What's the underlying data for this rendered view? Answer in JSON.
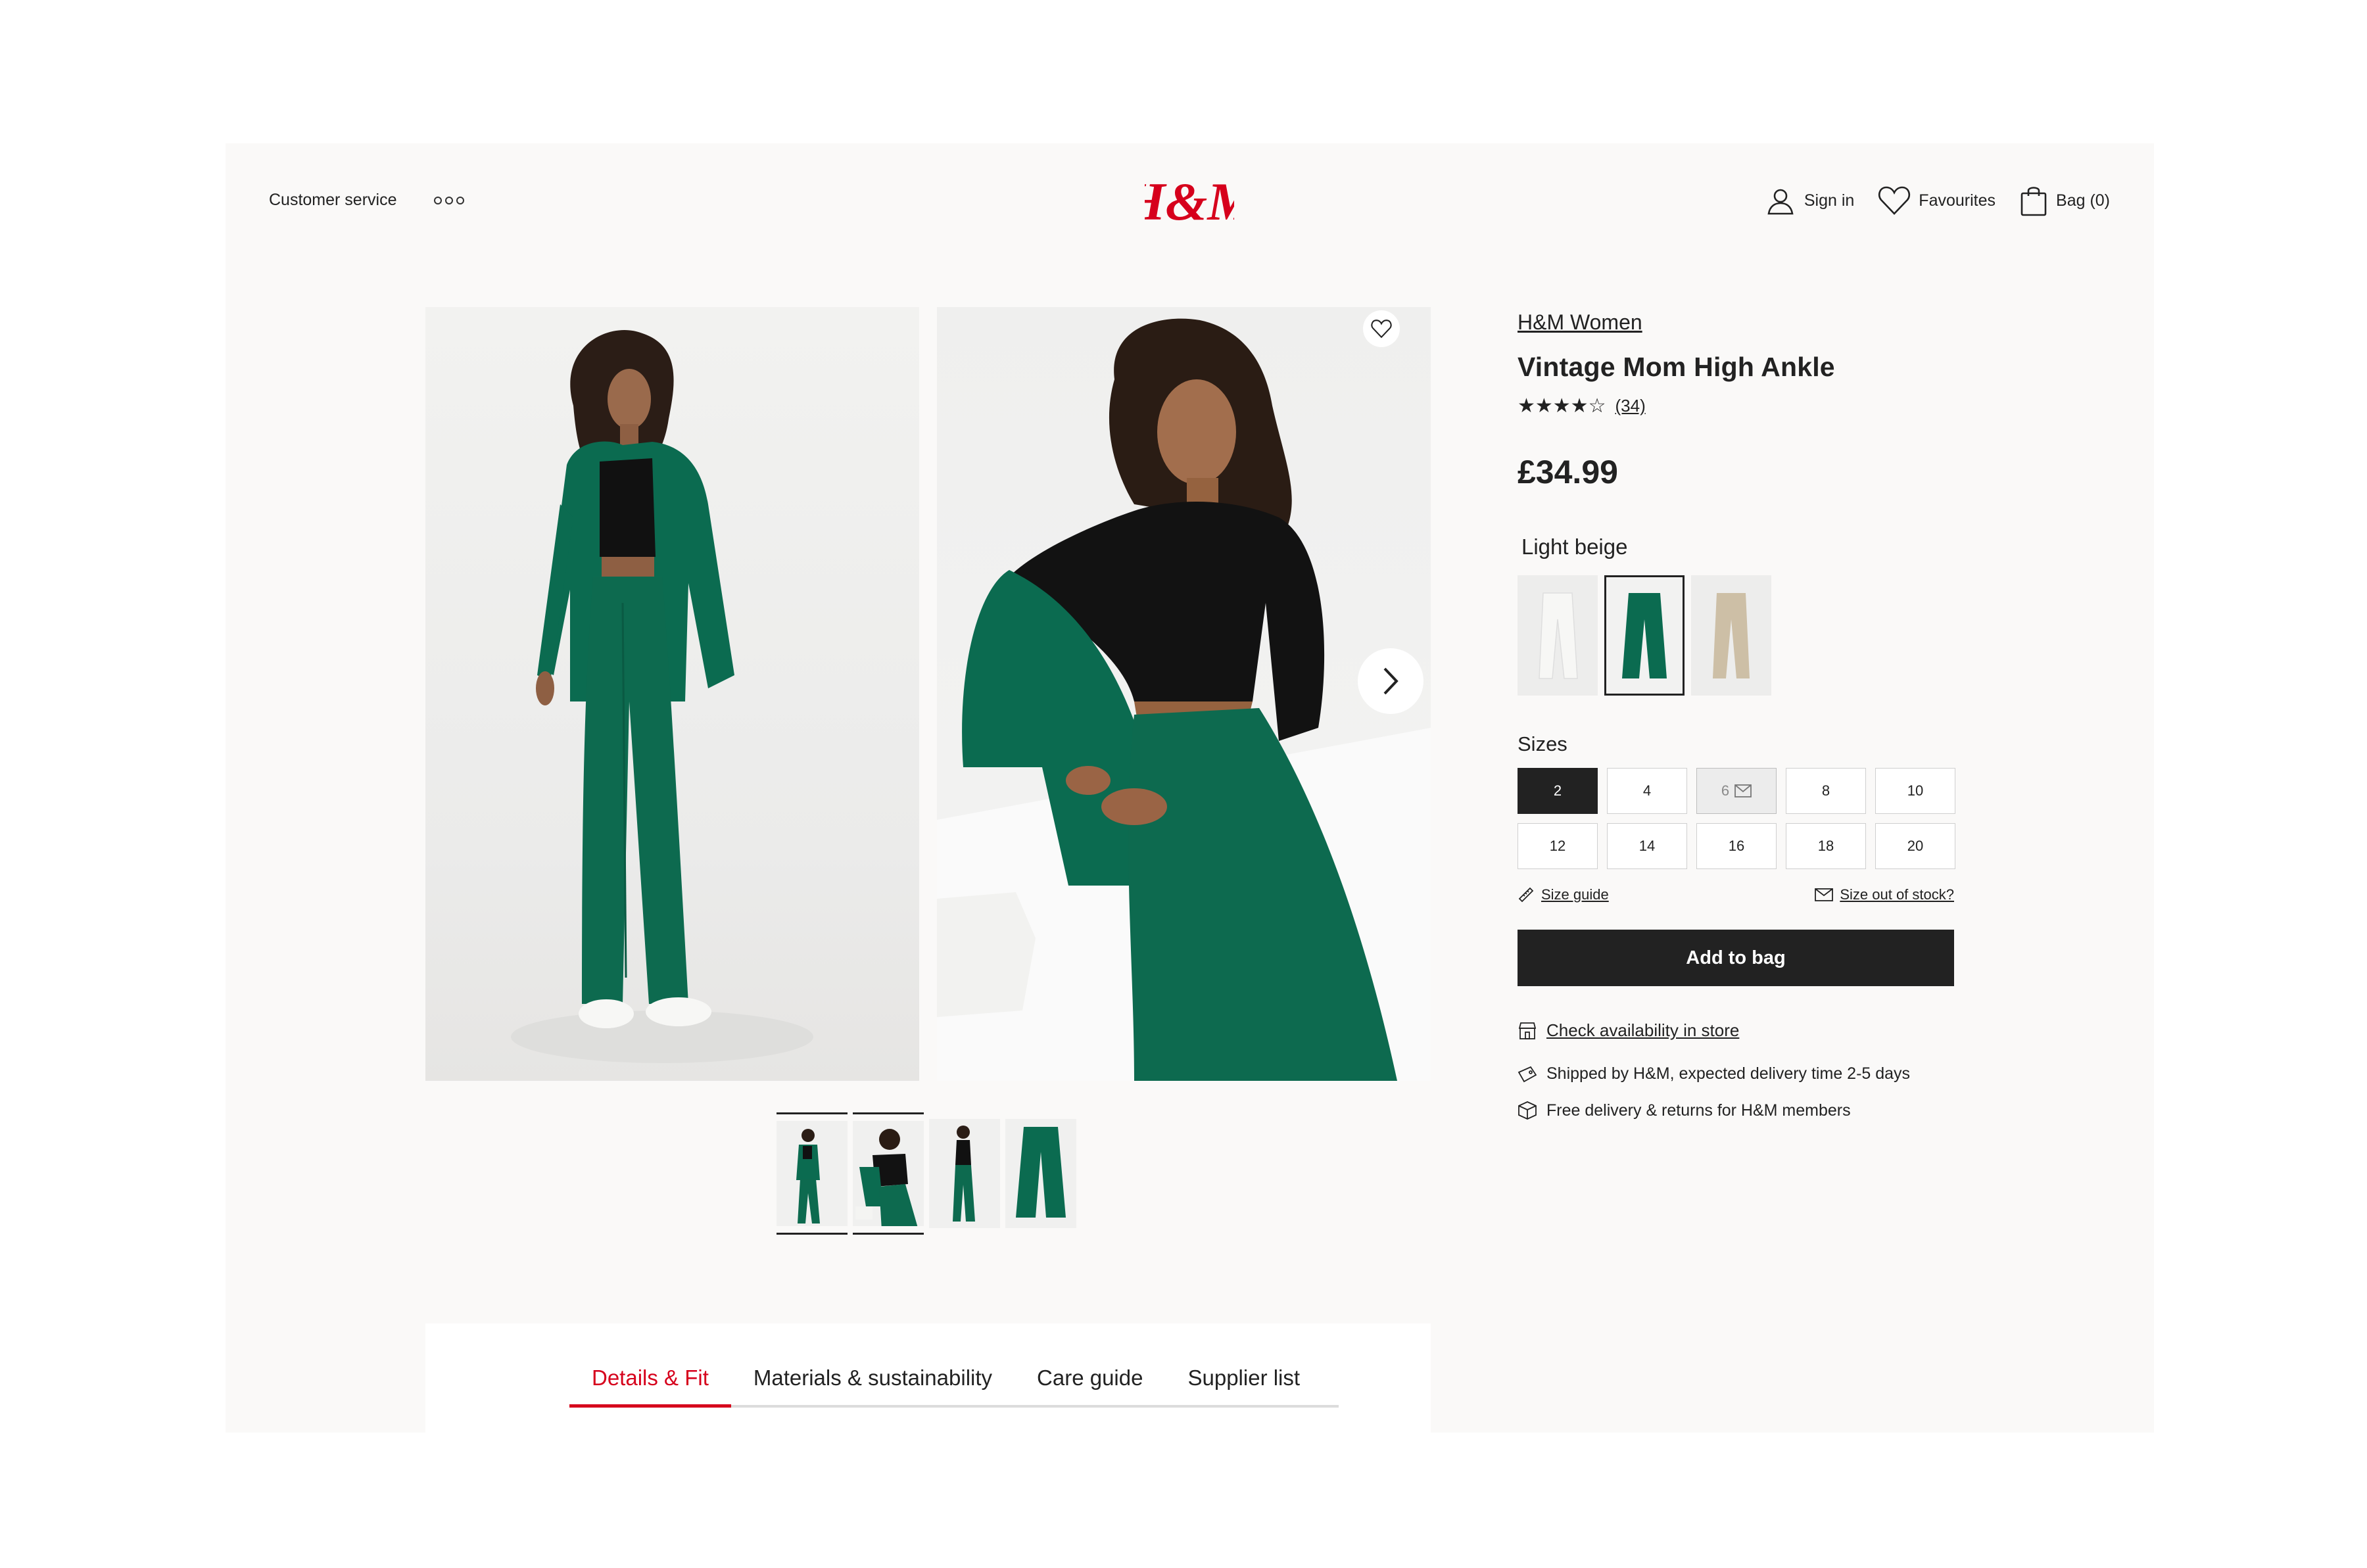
{
  "header": {
    "customer_service": "Customer service",
    "more_icon": "more-dots-icon",
    "logo": "H&M",
    "sign_in": "Sign in",
    "favourites": "Favourites",
    "bag": "Bag (0)"
  },
  "product": {
    "brand": "H&M Women",
    "title": "Vintage Mom High Ankle",
    "stars": "★★★★☆",
    "rating": 4,
    "reviews": "(34)",
    "price": "£34.99",
    "color_name": "Light beige",
    "sizes_label": "Sizes",
    "sizes": [
      {
        "label": "2",
        "state": "selected"
      },
      {
        "label": "4",
        "state": "available"
      },
      {
        "label": "6",
        "state": "out-of-stock"
      },
      {
        "label": "8",
        "state": "available"
      },
      {
        "label": "10",
        "state": "available"
      },
      {
        "label": "12",
        "state": "available"
      },
      {
        "label": "14",
        "state": "available"
      },
      {
        "label": "16",
        "state": "available"
      },
      {
        "label": "18",
        "state": "available"
      },
      {
        "label": "20",
        "state": "available"
      }
    ],
    "size_guide": "Size guide",
    "size_out_of_stock": "Size out of stock?",
    "add_to_bag": "Add to bag",
    "check_availability": "Check availability in store",
    "shipping": "Shipped by H&M, expected delivery time 2-5 days",
    "free_delivery": "Free delivery & returns for H&M members"
  },
  "tabs": [
    {
      "label": "Details & Fit",
      "active": true
    },
    {
      "label": "Materials & sustainability",
      "active": false
    },
    {
      "label": "Care guide",
      "active": false
    },
    {
      "label": "Supplier list",
      "active": false
    }
  ],
  "colors": {
    "brand_red": "#d6001c",
    "garment_green": "#0b6b50",
    "dark": "#222222"
  }
}
